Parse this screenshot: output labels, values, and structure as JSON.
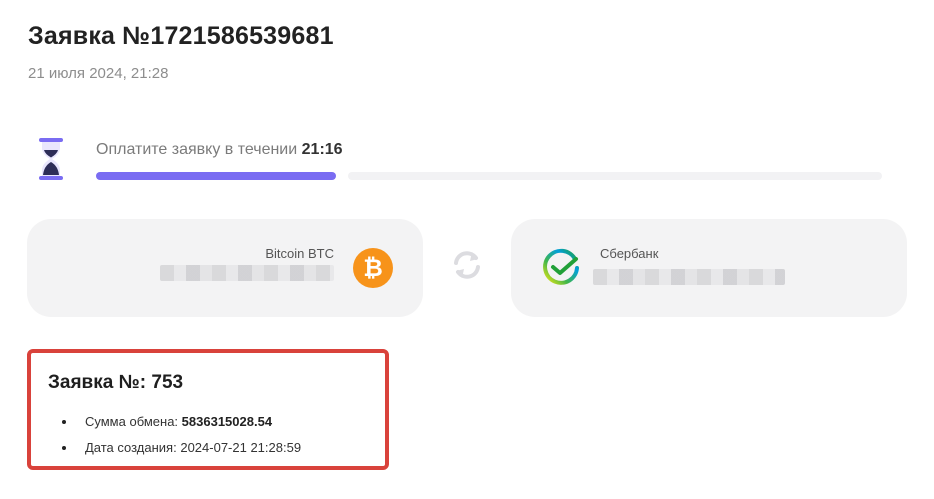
{
  "header": {
    "title": "Заявка №1721586539681",
    "date": "21 июля 2024, 21:28"
  },
  "timer": {
    "label": "Оплатите заявку в течении",
    "value": "21:16",
    "progress_fraction": 0.305
  },
  "exchange": {
    "from": {
      "name": "Bitcoin BTC",
      "icon": "bitcoin-icon",
      "color": "#f7931a"
    },
    "to": {
      "name": "Сбербанк",
      "icon": "sberbank-icon",
      "color": "#21a038"
    },
    "swap_icon": "swap-arrows-icon"
  },
  "order": {
    "title": "Заявка №: 753",
    "amount_label": "Сумма обмена:",
    "amount_value": "5836315028.54",
    "created_label": "Дата создания:",
    "created_value": "2024-07-21 21:28:59"
  },
  "colors": {
    "accent": "#7a6cf2",
    "highlight_border": "#d9423b",
    "card_bg": "#f3f3f4"
  }
}
